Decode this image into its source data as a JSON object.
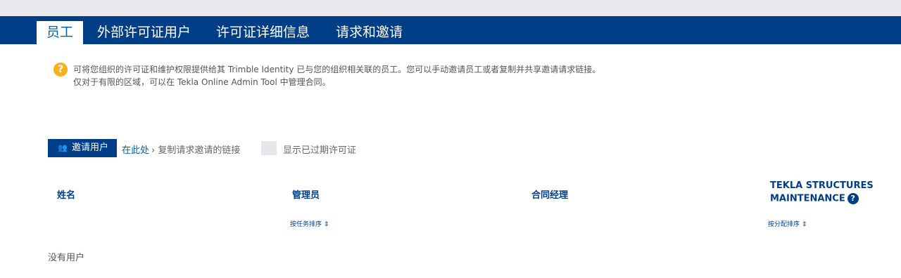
{
  "tabs": [
    {
      "label": "员工",
      "active": true
    },
    {
      "label": "外部许可证用户"
    },
    {
      "label": "许可证详细信息"
    },
    {
      "label": "请求和邀请"
    }
  ],
  "info": {
    "icon": "question-icon",
    "line1": "可将您组织的许可证和维护权限提供给其 Trimble Identity 已与您的组织相关联的员工。您可以手动邀请员工或者复制并共享邀请请求链接。",
    "line2": "仅对于有限的区域，可以在 Tekla Online Admin Tool 中管理合同。"
  },
  "actions": {
    "invite_label": "邀请用户",
    "invite_icon": "users-icon",
    "here_link": "在此处",
    "copy_link": "› 复制请求邀请的链接",
    "show_expired_label": "显示已过期许可证"
  },
  "table": {
    "columns": [
      "姓名",
      "管理员",
      "合同经理",
      "TEKLA STRUCTURES",
      "MAINTENANCE"
    ],
    "help_glyph": "?",
    "sort_by_role": "按任务排序 ⇕",
    "sort_by_assign": "按分配排序 ⇕",
    "empty": "没有用户"
  },
  "colors": {
    "nav": "#003f87",
    "accent": "#0063a3",
    "warning": "#f5b21b"
  }
}
